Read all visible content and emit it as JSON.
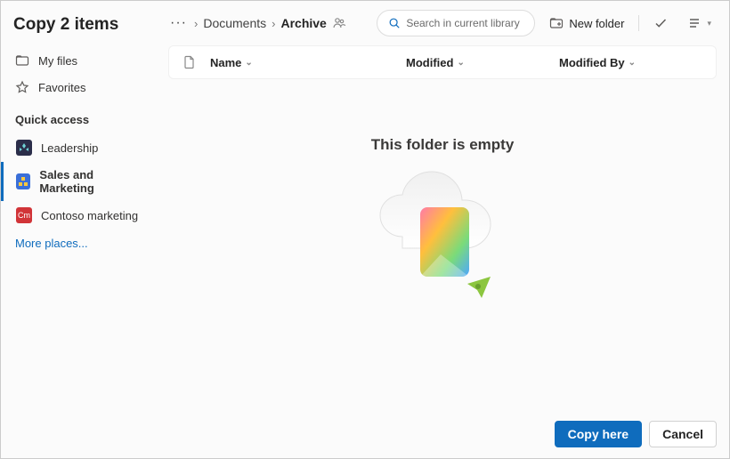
{
  "dialog": {
    "title": "Copy 2 items"
  },
  "sidebar": {
    "links": [
      {
        "id": "my-files",
        "label": "My files"
      },
      {
        "id": "favorites",
        "label": "Favorites"
      }
    ],
    "quick_access_title": "Quick access",
    "qa": [
      {
        "id": "leadership",
        "label": "Leadership",
        "color": "#2b2e4a"
      },
      {
        "id": "sales",
        "label": "Sales and Marketing",
        "color": "#3a6fd8"
      },
      {
        "id": "contoso",
        "label": "Contoso marketing",
        "color": "#d13438"
      }
    ],
    "more_label": "More places..."
  },
  "breadcrumb": {
    "items": [
      {
        "label": "Documents",
        "current": false
      },
      {
        "label": "Archive",
        "current": true
      }
    ]
  },
  "search": {
    "placeholder": "Search in current library"
  },
  "header_actions": {
    "new_folder": "New folder"
  },
  "table": {
    "columns": {
      "name": "Name",
      "modified": "Modified",
      "modified_by": "Modified By"
    }
  },
  "empty": {
    "title": "This folder is empty"
  },
  "footer": {
    "primary": "Copy here",
    "cancel": "Cancel"
  }
}
